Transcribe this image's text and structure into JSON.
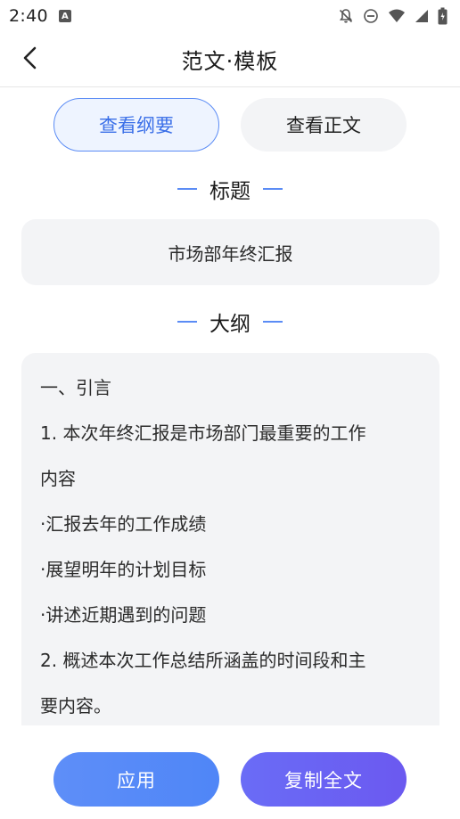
{
  "status_bar": {
    "time": "2:40",
    "notification_icon": "a-notification-icon",
    "icons": [
      "bell-off-icon",
      "do-not-disturb-icon",
      "wifi-icon",
      "signal-icon",
      "battery-icon"
    ]
  },
  "header": {
    "title": "范文·模板",
    "back_icon": "chevron-left-icon"
  },
  "tabs": [
    {
      "label": "查看纲要",
      "active": true
    },
    {
      "label": "查看正文",
      "active": false
    }
  ],
  "title_section": {
    "heading": "标题",
    "value": "市场部年终汇报"
  },
  "outline_section": {
    "heading": "大纲",
    "lines": [
      "一、引言",
      "1. 本次年终汇报是市场部门最重要的工作",
      "内容",
      "·汇报去年的工作成绩",
      "·展望明年的计划目标",
      "·讲述近期遇到的问题",
      "2. 概述本次工作总结所涵盖的时间段和主",
      "要内容。"
    ]
  },
  "actions": {
    "apply_label": "应用",
    "copy_label": "复制全文"
  },
  "colors": {
    "accent": "#5b8cf5",
    "apply_button": "#5589f7",
    "copy_button": "#6b62f3",
    "card_background": "#f3f4f6"
  }
}
